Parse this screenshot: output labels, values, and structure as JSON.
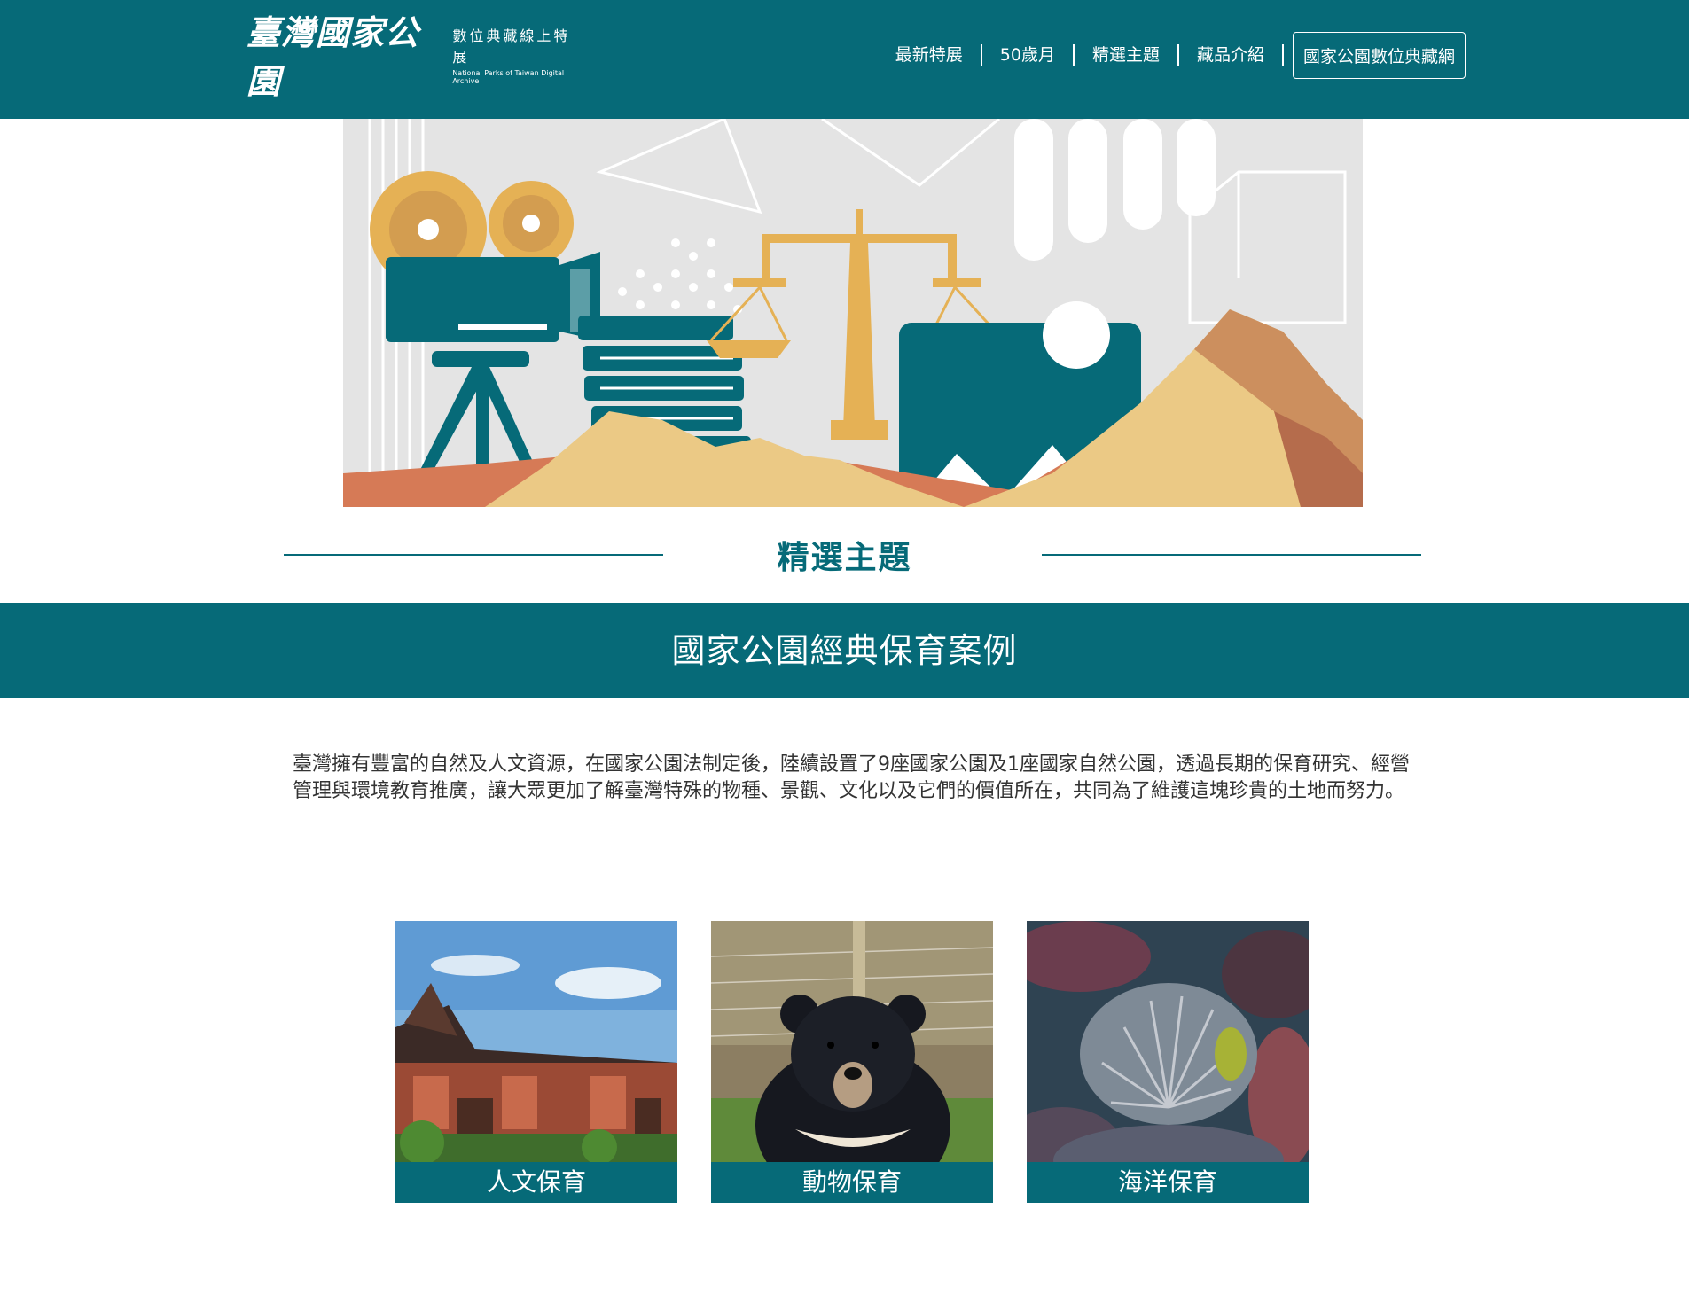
{
  "header": {
    "logo_main": "臺灣國家公園",
    "logo_sub_zh": "數位典藏線上特展",
    "logo_sub_en": "National Parks of Taiwan Digital Archive",
    "nav": [
      "最新特展",
      "50歲月",
      "精選主題",
      "藏品介紹"
    ],
    "archive_button": "國家公園數位典藏網"
  },
  "section": {
    "title": "精選主題",
    "band_title": "國家公園經典保育案例",
    "intro": "臺灣擁有豐富的自然及人文資源，在國家公園法制定後，陸續設置了9座國家公園及1座國家自然公園，透過長期的保育研究、經營管理與環境教育推廣，讓大眾更加了解臺灣特殊的物種、景觀、文化以及它們的價值所在，共同為了維護這塊珍貴的土地而努力。"
  },
  "cards": [
    {
      "label": "人文保育"
    },
    {
      "label": "動物保育"
    },
    {
      "label": "海洋保育"
    }
  ],
  "colors": {
    "brand": "#066a78",
    "accent": "#e5b155"
  }
}
